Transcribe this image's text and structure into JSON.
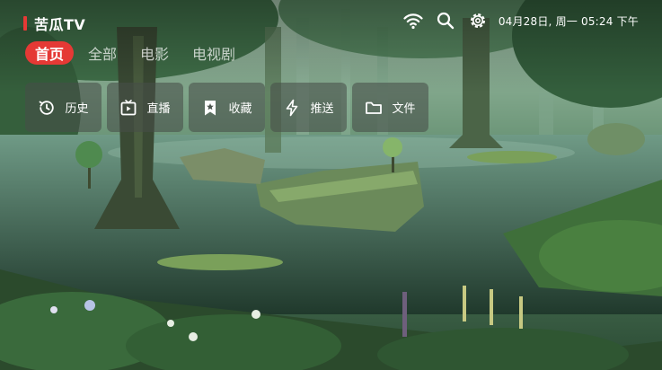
{
  "app": {
    "title": "苦瓜TV",
    "accent": "#e53935"
  },
  "status": {
    "icons": [
      "wifi-icon",
      "search-icon",
      "gear-icon"
    ],
    "datetime": "04月28日, 周一 05:24 下午"
  },
  "tabs": [
    {
      "label": "首页",
      "active": true
    },
    {
      "label": "全部"
    },
    {
      "label": "电影"
    },
    {
      "label": "电视剧"
    }
  ],
  "quick_actions": [
    {
      "label": "历史",
      "icon": "history-icon"
    },
    {
      "label": "直播",
      "icon": "live-tv-icon"
    },
    {
      "label": "收藏",
      "icon": "bookmark-star-icon"
    },
    {
      "label": "推送",
      "icon": "lightning-icon"
    },
    {
      "label": "文件",
      "icon": "folder-icon"
    }
  ]
}
